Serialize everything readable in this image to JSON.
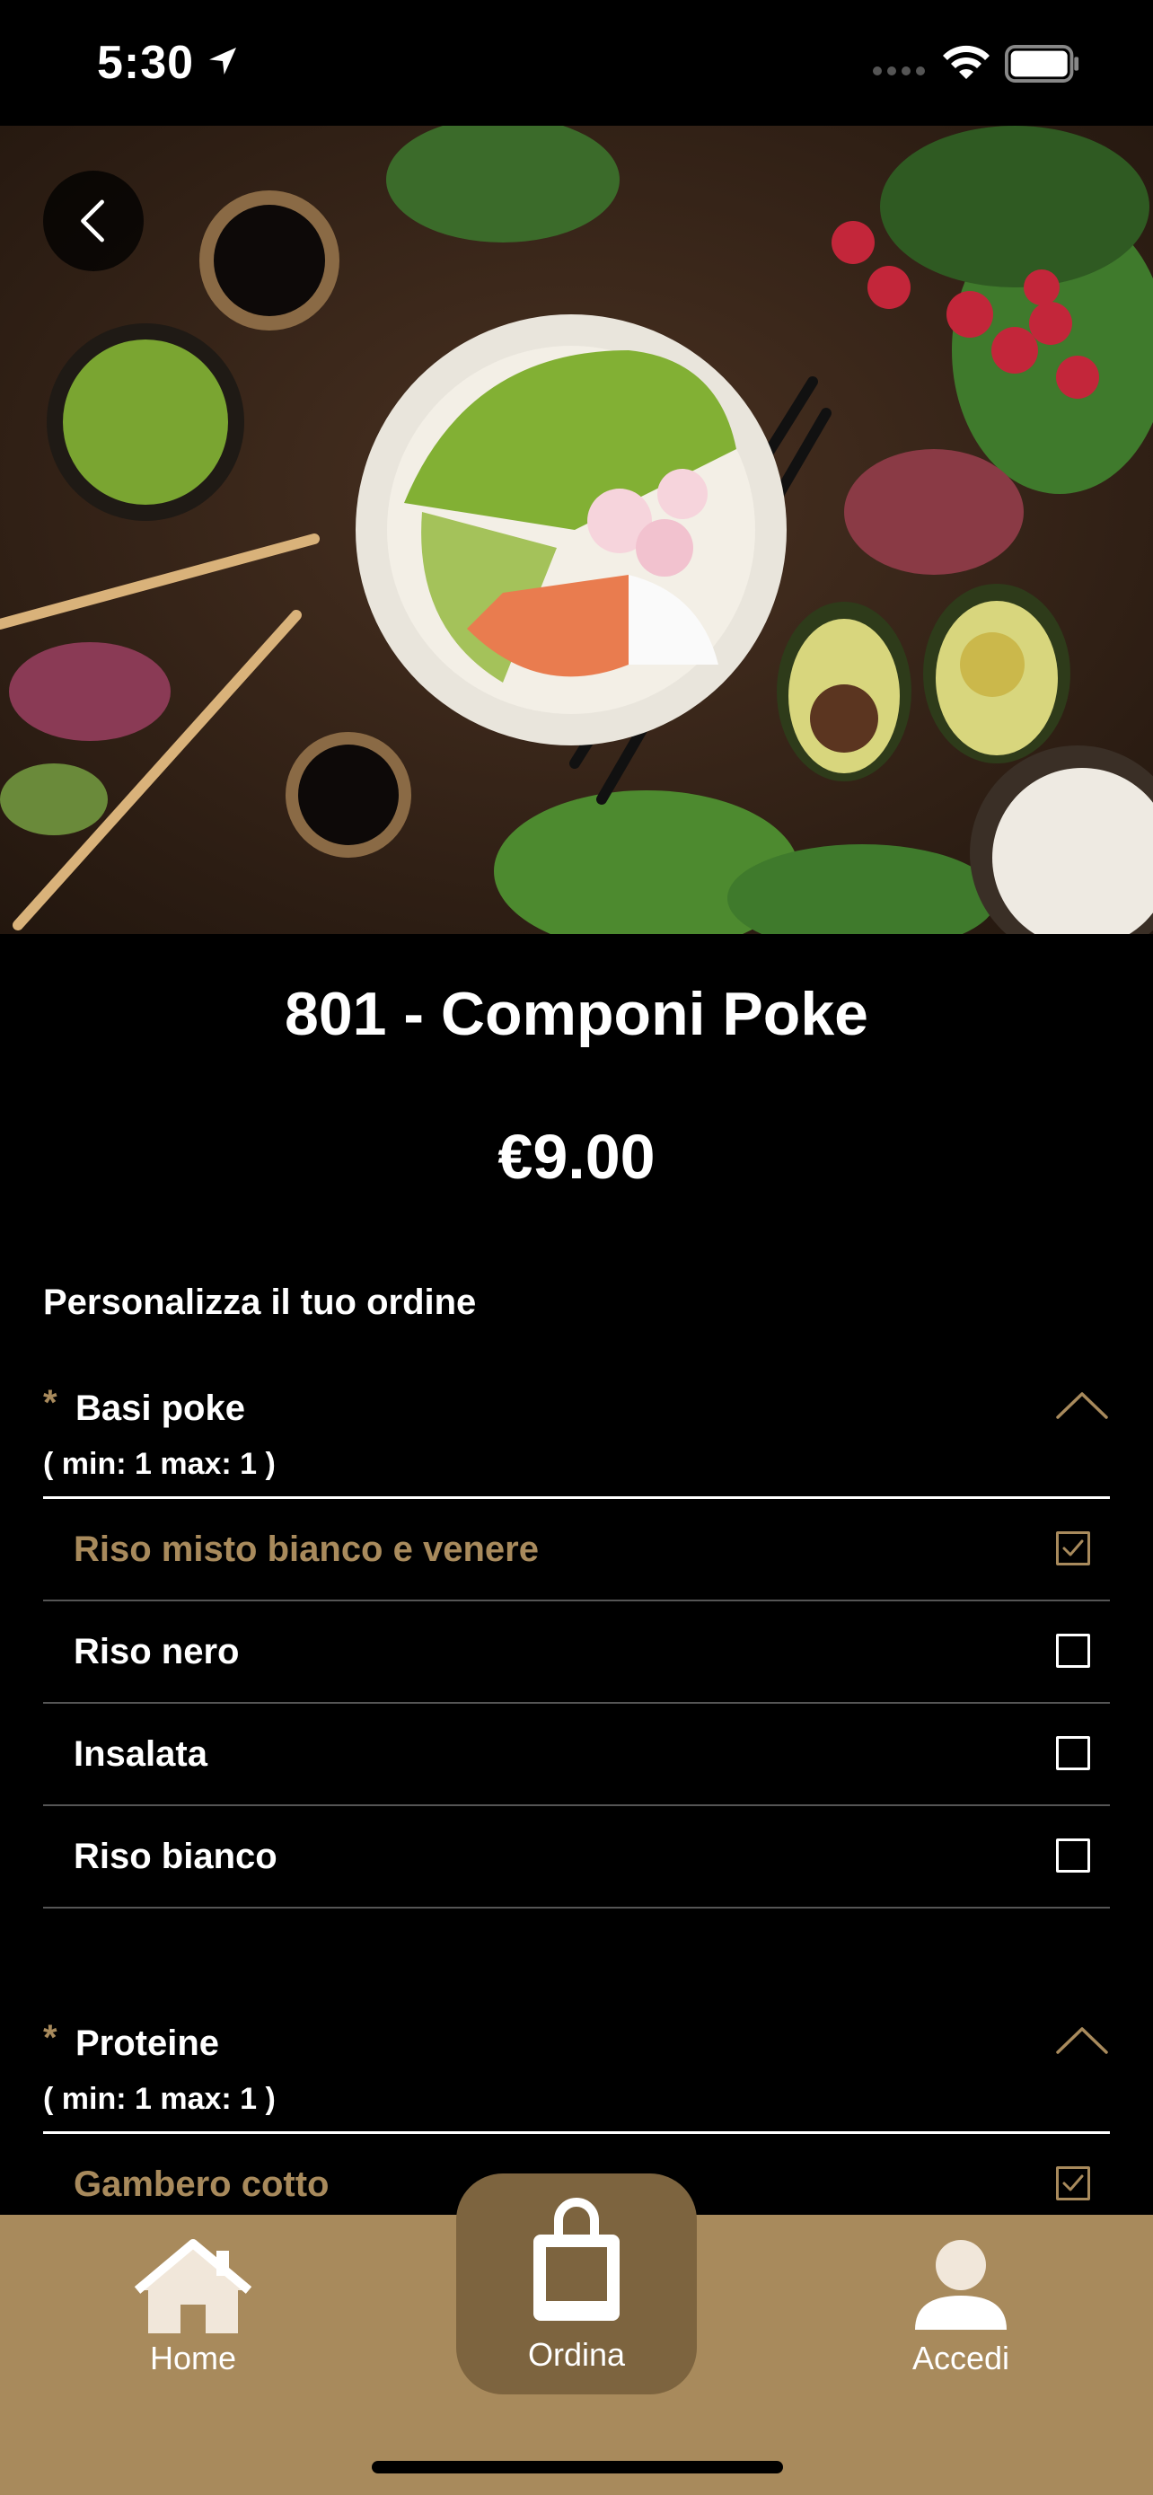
{
  "status_bar": {
    "time": "5:30"
  },
  "product": {
    "title": "801 - Componi Poke",
    "price": "€9.00",
    "hero_image": "poke bowl with edamame, salmon, avocado, radish and rice on dark table"
  },
  "customize": {
    "heading": "Personalizza il tuo ordine",
    "groups": [
      {
        "required_mark": "*",
        "title": "Basi poke",
        "constraints": "( min: 1 max: 1 )",
        "options": [
          {
            "label": "Riso misto bianco e venere",
            "selected": true
          },
          {
            "label": "Riso nero",
            "selected": false
          },
          {
            "label": "Insalata",
            "selected": false
          },
          {
            "label": "Riso bianco",
            "selected": false
          }
        ]
      },
      {
        "required_mark": "*",
        "title": "Proteine",
        "constraints": "( min: 1 max: 1 )",
        "options": [
          {
            "label": "Gambero cotto",
            "selected": true
          }
        ]
      }
    ]
  },
  "tabbar": {
    "home": "Home",
    "order": "Ordina",
    "login": "Accedi"
  },
  "colors": {
    "accent": "#a88a5c",
    "accent_dark": "#7d643f",
    "background": "#000000"
  },
  "icons": [
    "location-arrow-icon",
    "wifi-icon",
    "battery-icon",
    "back-chevron-icon",
    "chevron-up-icon",
    "checkbox-icon",
    "home-icon",
    "shopping-bag-icon",
    "user-icon"
  ]
}
